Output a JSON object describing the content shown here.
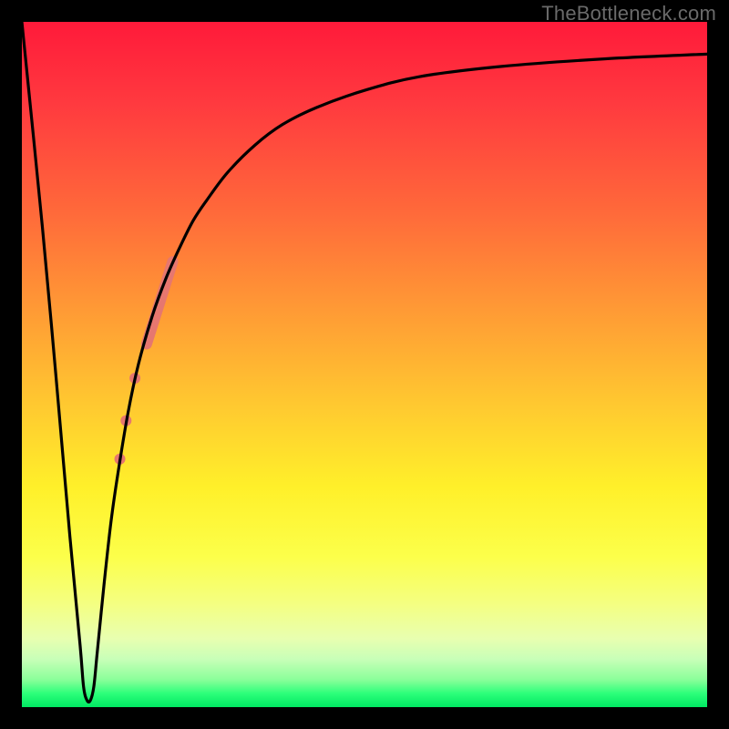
{
  "watermark": "TheBottleneck.com",
  "colors": {
    "frame": "#000000",
    "curve": "#000000",
    "marker": "#e6776f",
    "gradient_top": "#ff1a3a",
    "gradient_bottom": "#00e862"
  },
  "chart_data": {
    "type": "line",
    "title": "",
    "xlabel": "",
    "ylabel": "",
    "xlim": [
      0,
      100
    ],
    "ylim": [
      0,
      100
    ],
    "curve": {
      "x": [
        0,
        3,
        5,
        7,
        8.5,
        9,
        9.5,
        10,
        10.5,
        11,
        12,
        13,
        14,
        15.5,
        17,
        19,
        21,
        23,
        25,
        27,
        30,
        34,
        38,
        43,
        50,
        58,
        70,
        85,
        100
      ],
      "y": [
        100,
        70,
        48,
        25,
        9,
        3,
        1,
        1,
        3,
        8,
        18,
        27,
        34,
        43,
        50,
        57,
        62.5,
        67,
        71,
        74,
        78,
        82,
        85,
        87.5,
        90,
        92,
        93.5,
        94.6,
        95.3
      ]
    },
    "markers": [
      {
        "type": "segment",
        "x1": 18.2,
        "y1": 53.0,
        "x2": 22.0,
        "y2": 65.0,
        "width": 12
      },
      {
        "type": "dot",
        "x": 16.5,
        "y": 48.0,
        "r": 6
      },
      {
        "type": "dot",
        "x": 15.2,
        "y": 41.8,
        "r": 6
      },
      {
        "type": "dot",
        "x": 14.3,
        "y": 36.2,
        "r": 6
      }
    ]
  }
}
